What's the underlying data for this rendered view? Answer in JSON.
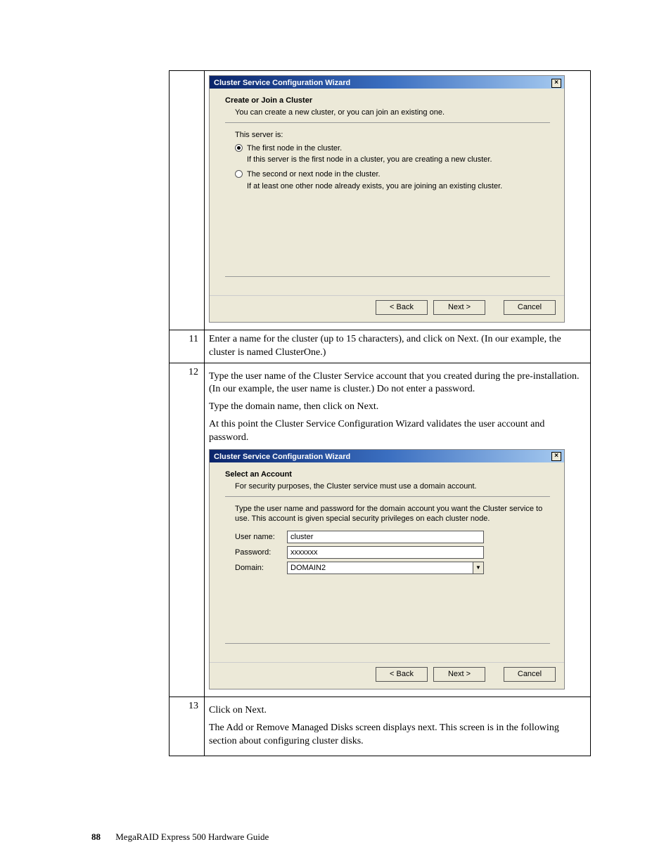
{
  "dialog1": {
    "title": "Cluster Service Configuration Wizard",
    "heading": "Create or Join a Cluster",
    "subtitle": "You can create a new cluster, or you can join an existing one.",
    "server_is": "This server is:",
    "radio1_label": "The first node in the cluster.",
    "radio1_expl": "If this server is the first node in a cluster, you are creating a new cluster.",
    "radio2_label": "The second or next node in the cluster.",
    "radio2_expl": "If at least one other node already exists, you are joining an existing cluster.",
    "back": "< Back",
    "next": "Next >",
    "cancel": "Cancel"
  },
  "step11": {
    "num": "11",
    "text": "Enter a name for the cluster (up to 15 characters), and click on Next. (In our example, the cluster is named ClusterOne.)"
  },
  "step12": {
    "num": "12",
    "p1": "Type the user name of the Cluster Service account that you created during the pre-installation. (In our example, the user name is cluster.) Do not enter a password.",
    "p2": "Type the domain name, then click on Next.",
    "p3": "At this point the Cluster Service Configuration Wizard validates the user account and password."
  },
  "dialog2": {
    "title": "Cluster Service Configuration Wizard",
    "heading": "Select an Account",
    "subtitle": "For security purposes, the Cluster service must use a domain account.",
    "instr": "Type the user name and password for the domain account you want the Cluster service to use. This account is given special security privileges on each cluster node.",
    "user_label": "User name:",
    "user_value": "cluster",
    "pass_label": "Password:",
    "pass_value": "xxxxxxx",
    "domain_label": "Domain:",
    "domain_value": "DOMAIN2",
    "back": "< Back",
    "next": "Next >",
    "cancel": "Cancel"
  },
  "step13": {
    "num": "13",
    "p1": "Click on Next.",
    "p2": "The Add or Remove Managed Disks screen displays next. This screen is in the following section about configuring cluster disks."
  },
  "footer": {
    "page": "88",
    "title": "MegaRAID Express 500 Hardware Guide"
  }
}
